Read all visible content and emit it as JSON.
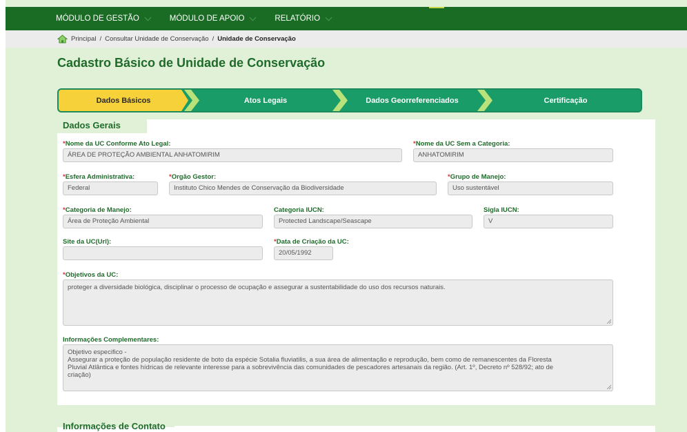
{
  "nav": {
    "menus": [
      {
        "label": "MÓDULO DE GESTÃO"
      },
      {
        "label": "MÓDULO DE APOIO"
      },
      {
        "label": "RELATÓRIO"
      }
    ]
  },
  "breadcrumb": {
    "home_icon": "home-icon",
    "items": [
      "Principal",
      "Consultar Unidade de Conservação",
      "Unidade de Conservação"
    ],
    "separator": "/"
  },
  "page": {
    "title": "Cadastro Básico de Unidade de Conservação"
  },
  "wizard": {
    "steps": [
      "Dados Básicos",
      "Atos Legais",
      "Dados Georreferenciados",
      "Certificação"
    ],
    "active_step": "Dados Básicos"
  },
  "form": {
    "section_title": "Dados Gerais",
    "required_mark": "*",
    "fields": {
      "nome_uc": {
        "label": "Nome da UC Conforme Ato Legal:",
        "value": "ÁREA DE PROTEÇÃO AMBIENTAL ANHATOMIRIM"
      },
      "nome_sem_categoria": {
        "label": "Nome da UC Sem a Categoria:",
        "value": "ANHATOMIRIM"
      },
      "esfera": {
        "label": "Esfera Administrativa:",
        "value": "Federal"
      },
      "orgao": {
        "label": "Orgão Gestor:",
        "value": "Instituto Chico Mendes de Conservação da Biodiversidade"
      },
      "grupo": {
        "label": "Grupo de Manejo:",
        "value": "Uso sustentável"
      },
      "categoria": {
        "label": "Categoria de Manejo:",
        "value": "Área de Proteção Ambiental"
      },
      "categoria_iucn": {
        "label": "Categoria IUCN:",
        "value": "Protected Landscape/Seascape"
      },
      "sigla_iucn": {
        "label": "Sigla IUCN:",
        "value": "V"
      },
      "site": {
        "label": "Site da UC(Url):",
        "value": ""
      },
      "data_criacao": {
        "label": "Data de Criação da UC:",
        "value": "20/05/1992"
      },
      "objetivos": {
        "label": "Objetivos da UC:",
        "value": "proteger a diversidade biológica, disciplinar o processo de ocupação e assegurar a sustentabilidade do uso dos recursos naturais."
      },
      "info_compl": {
        "label": "Informações Complementares:",
        "line1": "Objetivo especifico -",
        "line2": "Assegurar a proteção de população residente de boto da espécie Sotalia fluviatilis, a sua área de alimentação e reprodução, bem como de remanescentes da Floresta",
        "line3": "Pluvial Atlântica e fontes hídricas de relevante interesse para a sobrevivência das comunidades de pescadores artesanais da região. (Art. 1º, Decreto nº 528/92; ato de",
        "line4": "criação)"
      }
    }
  },
  "contact": {
    "section_title": "Informações de Contato"
  },
  "colors": {
    "nav_bg": "#1a6b24",
    "page_bg": "#e1f1d8",
    "title_green": "#1e6b2a",
    "wizard_green": "#1a9c69",
    "wizard_active": "#f6d13a",
    "required_red": "#d32f2f"
  }
}
